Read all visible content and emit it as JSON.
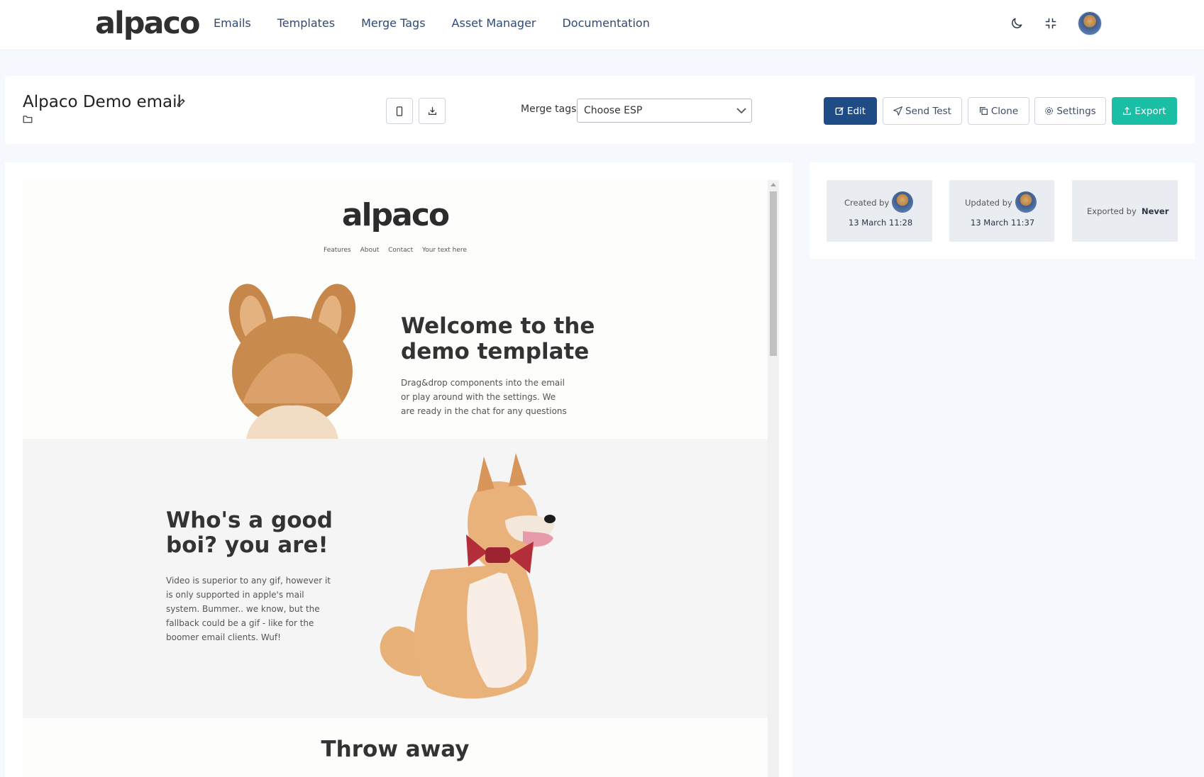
{
  "brand": {
    "logo_text": "alpaco"
  },
  "nav": {
    "items": [
      {
        "label": "Emails"
      },
      {
        "label": "Templates"
      },
      {
        "label": "Merge Tags"
      },
      {
        "label": "Asset Manager"
      },
      {
        "label": "Documentation"
      }
    ]
  },
  "top_icons": [
    "moon-icon",
    "collapse-icon",
    "avatar"
  ],
  "email": {
    "title": "Alpaco Demo email",
    "merge_tags_label": "Merge tags:",
    "merge_tags_value": "Choose ESP"
  },
  "actions": {
    "edit": "Edit",
    "send_test": "Send Test",
    "clone": "Clone",
    "settings": "Settings",
    "export": "Export"
  },
  "preview": {
    "logo_text": "alpaco",
    "links": [
      "Features",
      "About",
      "Contact",
      "Your text here"
    ],
    "hero_title": "Welcome to the demo template",
    "hero_text": "Drag&drop components into the email or play around with the settings. We are ready in the chat for any questions",
    "dog_title": "Who's a good boi? you are!",
    "dog_text": "Video is superior to any gif, however it is only supported in apple's mail system. Bummer.. we know, but the fallback could be a gif - like for the boomer email clients. Wuf!",
    "footer_title": "Throw away"
  },
  "meta": {
    "created_label": "Created by",
    "created_date": "13 March 11:28",
    "updated_label": "Updated by",
    "updated_date": "13 March 11:37",
    "exported_label": "Exported by",
    "exported_value": "Never"
  },
  "colors": {
    "primary": "#1f4c84",
    "success": "#19bea5",
    "nav_text": "#2e4a78"
  }
}
